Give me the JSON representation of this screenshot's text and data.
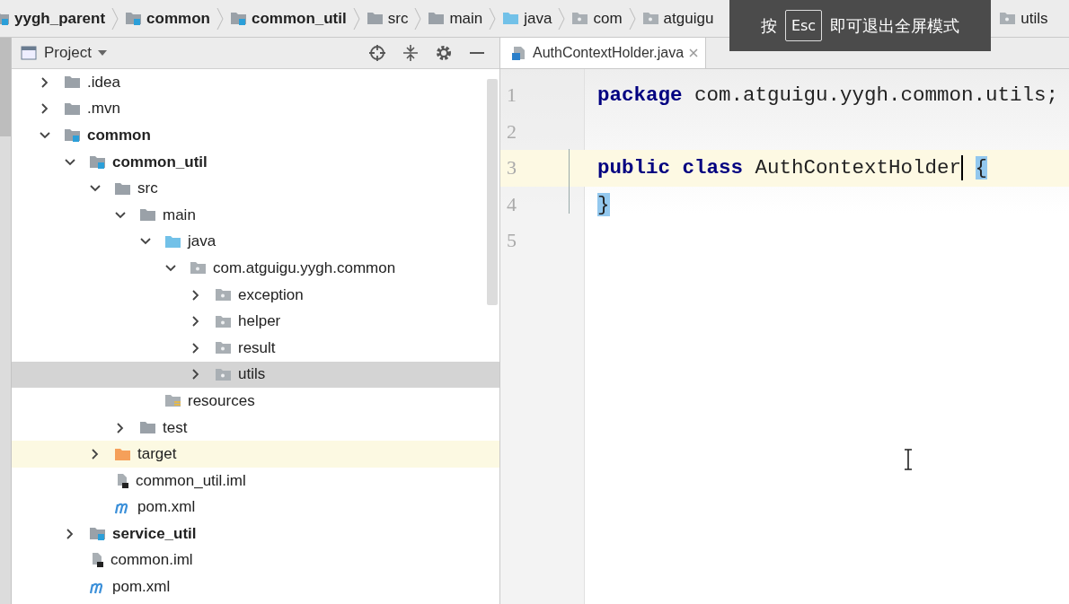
{
  "breadcrumb": [
    {
      "label": "yygh_parent",
      "kind": "module"
    },
    {
      "label": "common",
      "kind": "module"
    },
    {
      "label": "common_util",
      "kind": "module"
    },
    {
      "label": "src",
      "kind": "folder"
    },
    {
      "label": "main",
      "kind": "folder"
    },
    {
      "label": "java",
      "kind": "source"
    },
    {
      "label": "com",
      "kind": "package"
    },
    {
      "label": "atguigu",
      "kind": "package"
    },
    {
      "label": "utils",
      "kind": "package"
    }
  ],
  "fullscreen_notice": {
    "prefix": "按",
    "key": "Esc",
    "suffix": "即可退出全屏模式"
  },
  "project_panel": {
    "title": "Project",
    "tree": [
      {
        "label": ".idea",
        "kind": "folder",
        "expanded": false,
        "selected": false
      },
      {
        "label": ".mvn",
        "kind": "folder",
        "expanded": false,
        "selected": false
      },
      {
        "label": "common",
        "kind": "module",
        "expanded": true,
        "selected": false,
        "children": [
          {
            "label": "common_util",
            "kind": "module",
            "expanded": true,
            "selected": false,
            "children": [
              {
                "label": "src",
                "kind": "folder",
                "expanded": true,
                "selected": false,
                "children": [
                  {
                    "label": "main",
                    "kind": "folder",
                    "expanded": true,
                    "selected": false,
                    "children": [
                      {
                        "label": "java",
                        "kind": "source",
                        "expanded": true,
                        "selected": false,
                        "children": [
                          {
                            "label": "com.atguigu.yygh.common",
                            "kind": "package",
                            "expanded": true,
                            "selected": false,
                            "children": [
                              {
                                "label": "exception",
                                "kind": "package",
                                "expanded": false,
                                "selected": false
                              },
                              {
                                "label": "helper",
                                "kind": "package",
                                "expanded": false,
                                "selected": false
                              },
                              {
                                "label": "result",
                                "kind": "package",
                                "expanded": false,
                                "selected": false
                              },
                              {
                                "label": "utils",
                                "kind": "package",
                                "expanded": false,
                                "selected": true
                              }
                            ]
                          }
                        ]
                      },
                      {
                        "label": "resources",
                        "kind": "resources",
                        "selected": false
                      }
                    ]
                  },
                  {
                    "label": "test",
                    "kind": "folder",
                    "expanded": false,
                    "selected": false
                  }
                ]
              },
              {
                "label": "target",
                "kind": "excluded",
                "expanded": false,
                "selected": false
              },
              {
                "label": "common_util.iml",
                "kind": "iml",
                "selected": false
              },
              {
                "label": "pom.xml",
                "kind": "maven",
                "selected": false
              }
            ]
          },
          {
            "label": "service_util",
            "kind": "module",
            "expanded": false,
            "selected": false
          },
          {
            "label": "common.iml",
            "kind": "iml",
            "selected": false
          },
          {
            "label": "pom.xml",
            "kind": "maven",
            "selected": false
          }
        ]
      }
    ]
  },
  "editor": {
    "tabs": [
      {
        "label": "AuthContextHolder.java",
        "selected": true
      }
    ],
    "lines": [
      {
        "number": "1",
        "current": false,
        "tokens": [
          {
            "text": "package",
            "kind": "keyword"
          },
          {
            "text": " com.atguigu.yygh.common.utils;",
            "kind": "plain"
          }
        ]
      },
      {
        "number": "2",
        "current": false
      },
      {
        "number": "3",
        "current": true,
        "tokens": [
          {
            "text": "public",
            "kind": "keyword"
          },
          {
            "text": " class",
            "kind": "keyword"
          },
          {
            "text": " AuthContextHolder",
            "kind": "plain",
            "caret": true
          },
          {
            "text": " {",
            "kind": "brace-match"
          }
        ]
      },
      {
        "number": "4",
        "current": false,
        "tokens": [
          {
            "text": "}",
            "kind": "brace-match"
          }
        ]
      },
      {
        "number": "5",
        "current": false
      }
    ]
  }
}
